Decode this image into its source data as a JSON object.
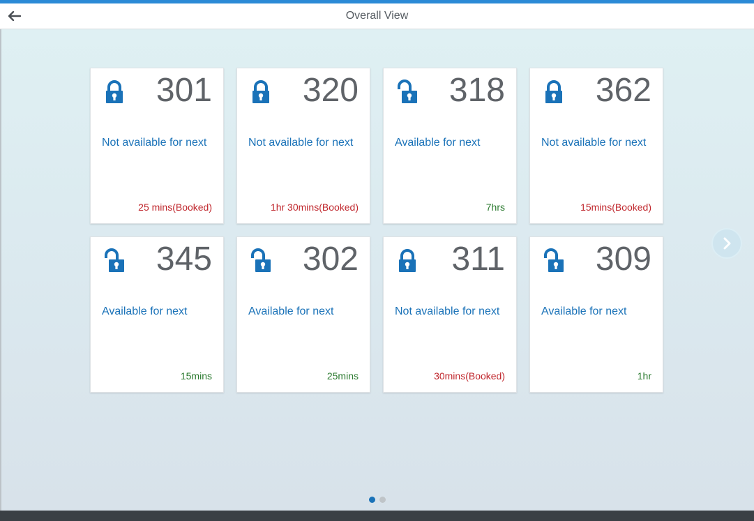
{
  "header": {
    "title": "Overall View",
    "back_icon": "arrow-left-icon"
  },
  "colors": {
    "accent": "#2b8ad6",
    "status_text": "#1a72b8",
    "booked": "#c0272d",
    "available": "#2b7a2f",
    "number": "#5f6368"
  },
  "rooms": [
    {
      "number": "301",
      "status": "Not available for next",
      "duration": "25 mins(Booked)",
      "locked": true
    },
    {
      "number": "320",
      "status": "Not available for next",
      "duration": "1hr 30mins(Booked)",
      "locked": true
    },
    {
      "number": "318",
      "status": "Available for next",
      "duration": "7hrs",
      "locked": false
    },
    {
      "number": "362",
      "status": "Not available for next",
      "duration": "15mins(Booked)",
      "locked": true
    },
    {
      "number": "345",
      "status": "Available for next",
      "duration": "15mins",
      "locked": false
    },
    {
      "number": "302",
      "status": "Available for next",
      "duration": "25mins",
      "locked": false
    },
    {
      "number": "311",
      "status": "Not available for next",
      "duration": "30mins(Booked)",
      "locked": true
    },
    {
      "number": "309",
      "status": "Available for next",
      "duration": "1hr",
      "locked": false
    }
  ],
  "pager": {
    "pages": 2,
    "active": 0
  },
  "navigation": {
    "next_icon": "chevron-right-icon"
  }
}
